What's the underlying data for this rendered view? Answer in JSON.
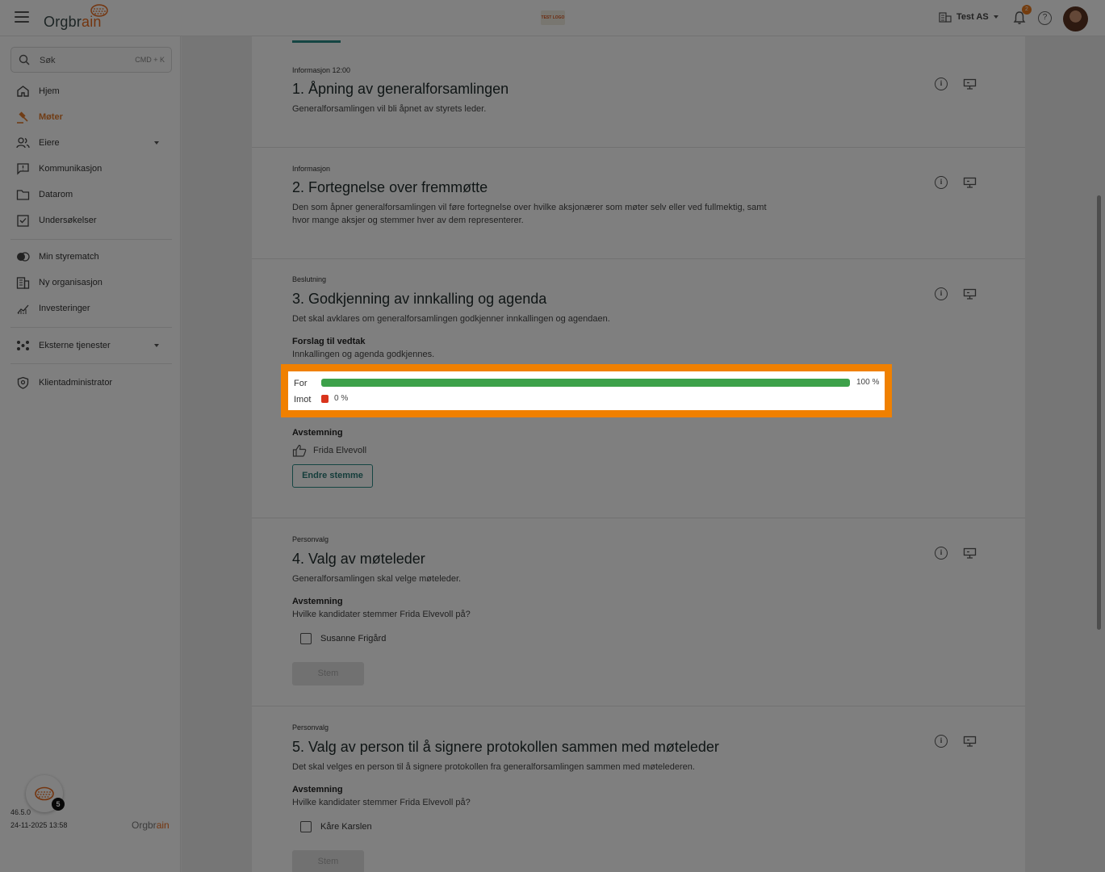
{
  "topbar": {
    "logo_text_a": "Orgbr",
    "logo_text_b": "ain",
    "center_logo": "TEST LOGO",
    "org_name": "Test AS",
    "notifications_count": "2",
    "help_label": "?"
  },
  "sidebar": {
    "search_label": "Søk",
    "search_shortcut": "CMD + K",
    "items": [
      {
        "label": "Hjem",
        "icon": "home-icon"
      },
      {
        "label": "Møter",
        "icon": "gavel-icon",
        "active": true
      },
      {
        "label": "Eiere",
        "icon": "owners-icon",
        "expandable": true
      },
      {
        "label": "Kommunikasjon",
        "icon": "message-icon"
      },
      {
        "label": "Datarom",
        "icon": "folder-icon"
      },
      {
        "label": "Undersøkelser",
        "icon": "survey-icon"
      },
      {
        "label": "Min styrematch",
        "icon": "toggle-icon"
      },
      {
        "label": "Ny organisasjon",
        "icon": "building-icon"
      },
      {
        "label": "Investeringer",
        "icon": "chart-icon"
      },
      {
        "label": "Eksterne tjenester",
        "icon": "services-icon",
        "expandable": true
      },
      {
        "label": "Klientadministrator",
        "icon": "shield-icon"
      }
    ],
    "fab_badge": "5",
    "version": "46.5.0",
    "version_date": "24-11-2025 13:58",
    "footer_logo_a": "Orgbr",
    "footer_logo_b": "ain"
  },
  "agenda": [
    {
      "type": "Informasjon 12:00",
      "title": "1. Åpning av generalforsamlingen",
      "description": "Generalforsamlingen vil bli åpnet av styrets leder."
    },
    {
      "type": "Informasjon",
      "title": "2. Fortegnelse over fremmøtte",
      "description": "Den som åpner generalforsamlingen vil føre fortegnelse over hvilke aksjonærer som møter selv eller ved fullmektig, samt hvor mange aksjer og stemmer hver av dem representerer."
    },
    {
      "type": "Beslutning",
      "title": "3. Godkjenning av innkalling og agenda",
      "description": "Det skal avklares om generalforsamlingen godkjenner innkallingen og agendaen.",
      "proposal_heading": "Forslag til vedtak",
      "proposal_text": "Innkallingen og agenda godkjennes.",
      "results": {
        "for_label": "For",
        "for_pct": "100 %",
        "for_value": 100,
        "against_label": "Imot",
        "against_pct": "0 %",
        "against_value": 0
      },
      "voting_heading": "Avstemning",
      "voter": "Frida Elvevoll",
      "change_vote_button": "Endre stemme"
    },
    {
      "type": "Personvalg",
      "title": "4. Valg av møteleder",
      "description": "Generalforsamlingen skal velge møteleder.",
      "voting_heading": "Avstemning",
      "voting_question": "Hvilke kandidater stemmer Frida Elvevoll på?",
      "candidate": "Susanne Frigård",
      "vote_button": "Stem"
    },
    {
      "type": "Personvalg",
      "title": "5. Valg av person til å signere protokollen sammen med møteleder",
      "description": "Det skal velges en person til å signere protokollen fra generalforsamlingen sammen med møtelederen.",
      "voting_heading": "Avstemning",
      "voting_question": "Hvilke kandidater stemmer Frida Elvevoll på?",
      "candidate": "Kåre Karslen",
      "vote_button": "Stem"
    }
  ],
  "colors": {
    "accent": "#2a8a86",
    "brand_orange": "#e86b1e",
    "highlight_border": "#f08000",
    "vote_for": "#3da14a",
    "vote_against": "#d9341c"
  }
}
